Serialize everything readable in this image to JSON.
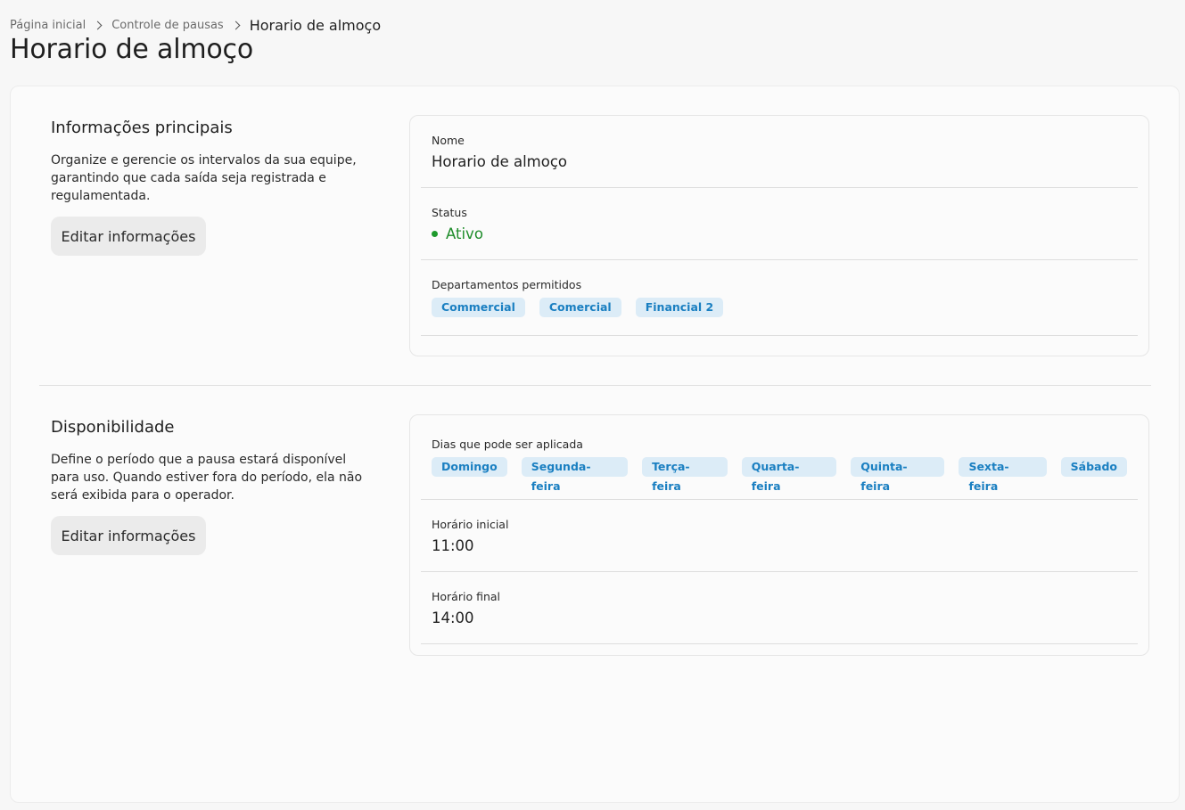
{
  "breadcrumb": {
    "home": "Página inicial",
    "parent": "Controle de pausas",
    "current": "Horario de almoço"
  },
  "page_title": "Horario de almoço",
  "main_info": {
    "heading": "Informações principais",
    "description": "Organize e gerencie os intervalos da sua equipe, garantindo que cada saída seja registrada e regulamentada.",
    "edit_label": "Editar informações",
    "name_label": "Nome",
    "name_value": "Horario de almoço",
    "status_label": "Status",
    "status_value": "Ativo",
    "departments_label": "Departamentos permitidos",
    "departments": [
      "Commercial",
      "Comercial",
      "Financial 2"
    ]
  },
  "availability": {
    "heading": "Disponibilidade",
    "description": "Define o período que a pausa estará disponível para uso. Quando estiver fora do período, ela não será exibida para o operador.",
    "edit_label": "Editar informações",
    "days_label": "Dias que pode ser aplicada",
    "days": [
      "Domingo",
      "Segunda-feira",
      "Terça-feira",
      "Quarta-feira",
      "Quinta-feira",
      "Sexta-feira",
      "Sábado"
    ],
    "start_label": "Horário inicial",
    "start_value": "11:00",
    "end_label": "Horário final",
    "end_value": "14:00"
  },
  "colors": {
    "status_active": "#1e8c2a",
    "chip_bg": "#dcecf7",
    "chip_text": "#1a7fc1"
  }
}
